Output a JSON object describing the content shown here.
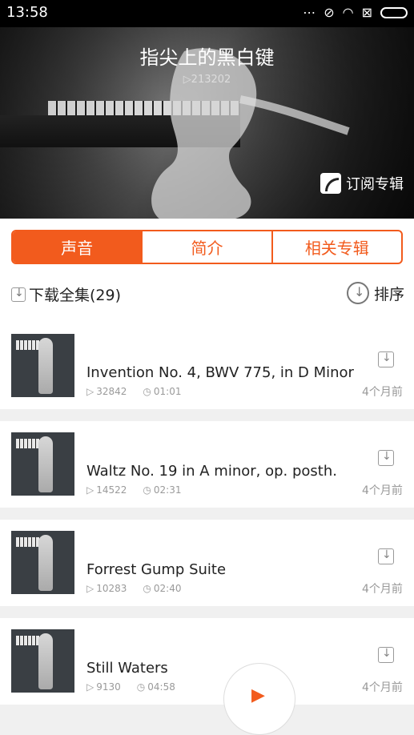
{
  "status": {
    "time": "13:58"
  },
  "hero": {
    "title": "指尖上的黑白键",
    "plays": "▷213202",
    "subscribe": "订阅专辑"
  },
  "tabs": [
    {
      "label": "声音",
      "active": true
    },
    {
      "label": "简介",
      "active": false
    },
    {
      "label": "相关专辑",
      "active": false
    }
  ],
  "actions": {
    "download_all": "下载全集(29)",
    "sort": "排序"
  },
  "tracks": [
    {
      "title": "Invention No. 4, BWV 775, in D Minor",
      "plays": "32842",
      "duration": "01:01",
      "ago": "4个月前"
    },
    {
      "title": "Waltz No. 19 in A minor, op. posth.",
      "plays": "14522",
      "duration": "02:31",
      "ago": "4个月前"
    },
    {
      "title": "Forrest Gump Suite",
      "plays": "10283",
      "duration": "02:40",
      "ago": "4个月前"
    },
    {
      "title": "Still Waters",
      "plays": "9130",
      "duration": "04:58",
      "ago": "4个月前"
    }
  ],
  "colors": {
    "accent": "#f25b1d"
  }
}
